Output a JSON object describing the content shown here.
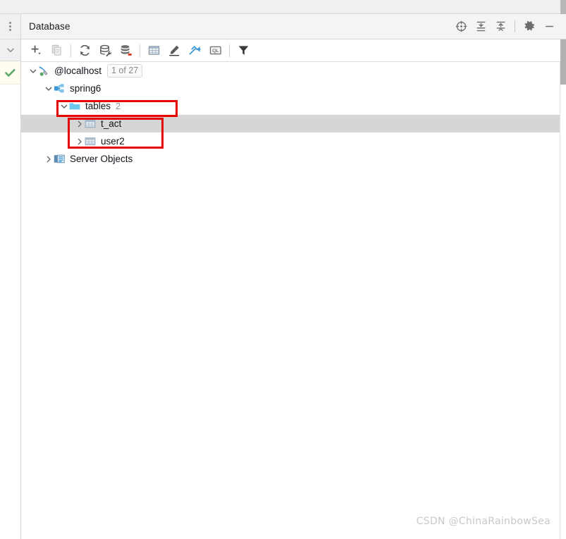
{
  "window": {
    "title": "Database"
  },
  "gutter": {
    "menu_icon": "more-vertical-icon",
    "collapse_icon": "chevron-down-icon",
    "status_icon": "green-check-icon"
  },
  "header": {
    "title": "Database",
    "actions": [
      {
        "name": "locate-in-tree-button",
        "icon": "crosshair-target-icon",
        "label": "Scroll from Source"
      },
      {
        "name": "expand-all-button",
        "icon": "expand-all-icon",
        "label": "Expand All"
      },
      {
        "name": "collapse-all-button",
        "icon": "collapse-all-icon",
        "label": "Collapse All"
      },
      {
        "name": "settings-button",
        "icon": "gear-icon",
        "label": "Options"
      },
      {
        "name": "hide-button",
        "icon": "minimize-icon",
        "label": "Hide"
      }
    ]
  },
  "toolbar": {
    "buttons": [
      {
        "name": "add-button",
        "icon": "plus-dropdown-icon",
        "label": "New",
        "enabled": true
      },
      {
        "name": "duplicate-button",
        "icon": "copy-icon",
        "label": "Duplicate",
        "enabled": false
      },
      {
        "name": "refresh-button",
        "icon": "refresh-icon",
        "label": "Refresh",
        "enabled": true
      },
      {
        "name": "datasource-properties-button",
        "icon": "database-wrench-icon",
        "label": "Data Source Properties",
        "enabled": true
      },
      {
        "name": "database-diff-button",
        "icon": "database-badge-icon",
        "label": "Synchronize",
        "enabled": true
      },
      {
        "name": "open-table-editor-button",
        "icon": "table-grid-icon",
        "label": "Open Table Editor",
        "enabled": true
      },
      {
        "name": "modify-button",
        "icon": "pencil-icon",
        "label": "Modify",
        "enabled": true
      },
      {
        "name": "jump-to-editor-button",
        "icon": "jump-to-icon",
        "label": "Jump to Editor",
        "enabled": true
      },
      {
        "name": "query-console-button",
        "icon": "ql-console-icon",
        "label": "Open Console",
        "enabled": true
      },
      {
        "name": "filter-button",
        "icon": "filter-funnel-icon",
        "label": "Filter",
        "enabled": true
      }
    ]
  },
  "tree": {
    "nodes": [
      {
        "name": "tree-node-localhost",
        "label": "@localhost",
        "badge": "1 of 27",
        "icon": "connection-icon",
        "expanded": true,
        "level": 0,
        "selected": false
      },
      {
        "name": "tree-node-spring6",
        "label": "spring6",
        "icon": "schema-icon",
        "expanded": true,
        "level": 1,
        "selected": false
      },
      {
        "name": "tree-node-tables",
        "label": "tables",
        "count": "2",
        "icon": "folder-icon",
        "expanded": true,
        "level": 2,
        "selected": false
      },
      {
        "name": "tree-node-t_act",
        "label": "t_act",
        "icon": "table-icon",
        "expanded": false,
        "level": 3,
        "selected": true
      },
      {
        "name": "tree-node-user2",
        "label": "user2",
        "icon": "table-icon",
        "expanded": false,
        "level": 3,
        "selected": false
      },
      {
        "name": "tree-node-server-objects",
        "label": "Server Objects",
        "icon": "server-objects-icon",
        "expanded": false,
        "level": 1,
        "selected": false
      }
    ]
  },
  "annotations": [
    {
      "name": "annotation-box-tables",
      "target": "tables",
      "color": "#e60000"
    },
    {
      "name": "annotation-box-table-list",
      "target": "t_act,user2",
      "color": "#e60000"
    }
  ],
  "watermark": {
    "text": "CSDN @ChinaRainbowSea"
  },
  "colors": {
    "accent_blue": "#3b99d6",
    "folder_blue": "#6ec8ef",
    "annotation_red": "#e60000",
    "selection_grey": "#d6d6d6",
    "header_grey": "#f4f4f4"
  }
}
